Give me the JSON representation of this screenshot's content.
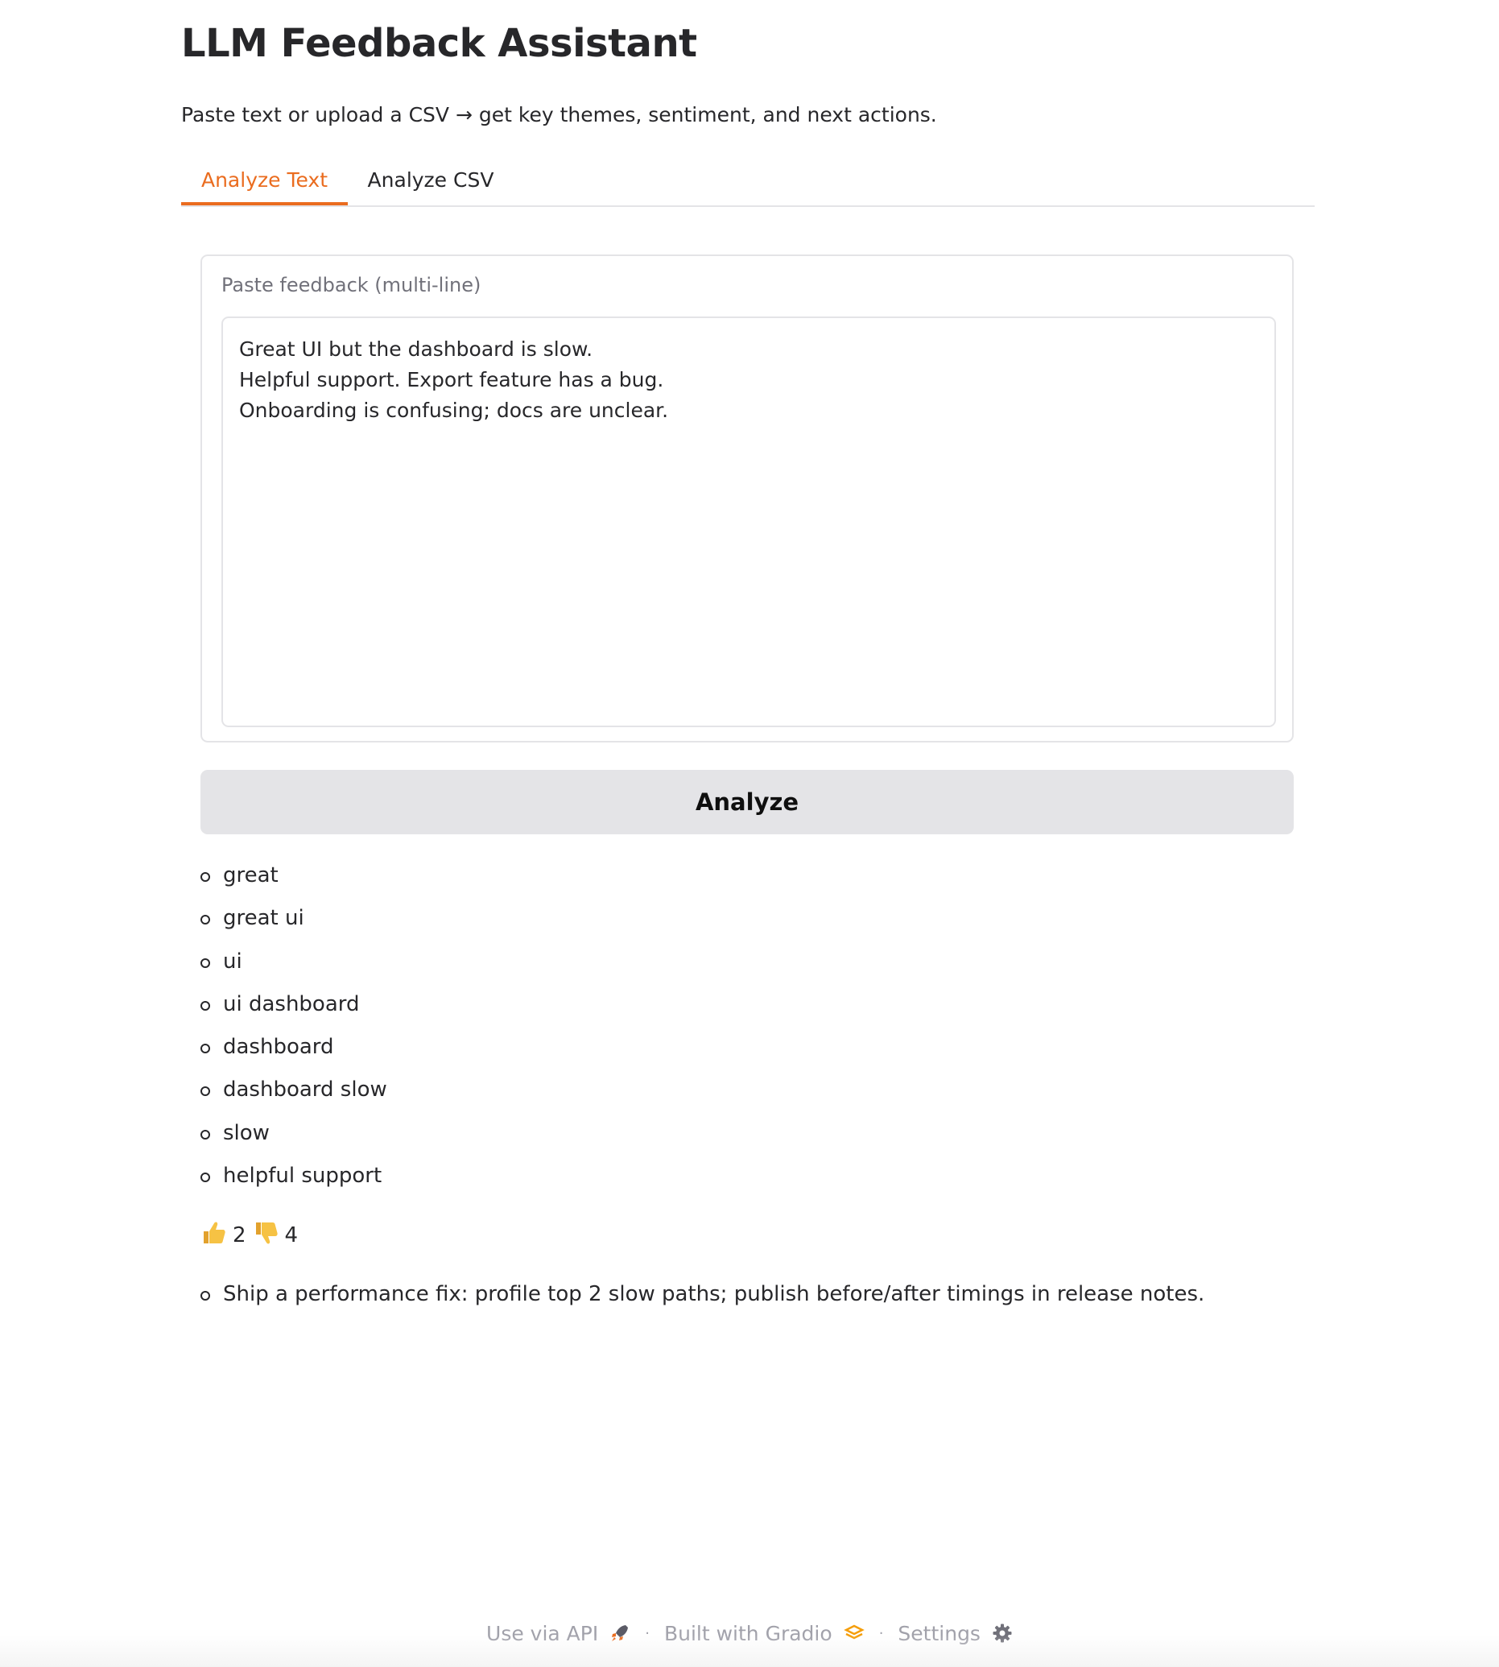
{
  "header": {
    "title": "LLM Feedback Assistant",
    "subtitle": "Paste text or upload a CSV → get key themes, sentiment, and next actions."
  },
  "tabs": [
    {
      "label": "Analyze Text",
      "active": true
    },
    {
      "label": "Analyze CSV",
      "active": false
    }
  ],
  "input": {
    "label": "Paste feedback (multi-line)",
    "value": "Great UI but the dashboard is slow.\nHelpful support. Export feature has a bug.\nOnboarding is confusing; docs are unclear."
  },
  "analyze_button": {
    "label": "Analyze"
  },
  "themes": [
    "great",
    "great ui",
    "ui",
    "ui dashboard",
    "dashboard",
    "dashboard slow",
    "slow",
    "helpful support"
  ],
  "sentiment": {
    "positive_icon": "thumbs-up-icon",
    "positive_count": "2",
    "negative_icon": "thumbs-down-icon",
    "negative_count": "4"
  },
  "actions": [
    "Ship a performance fix: profile top 2 slow paths; publish before/after timings in release notes."
  ],
  "footer": {
    "api_label": "Use via API",
    "api_icon": "rocket-icon",
    "built_label": "Built with Gradio",
    "built_icon": "gradio-logo-icon",
    "settings_label": "Settings",
    "settings_icon": "gear-icon"
  },
  "colors": {
    "accent": "#ea6c1f",
    "button_bg": "#e4e4e7",
    "border": "#e4e4e7",
    "muted_text": "#71717a",
    "footer_text": "#a1a1aa",
    "emoji": "#f2b53a"
  }
}
